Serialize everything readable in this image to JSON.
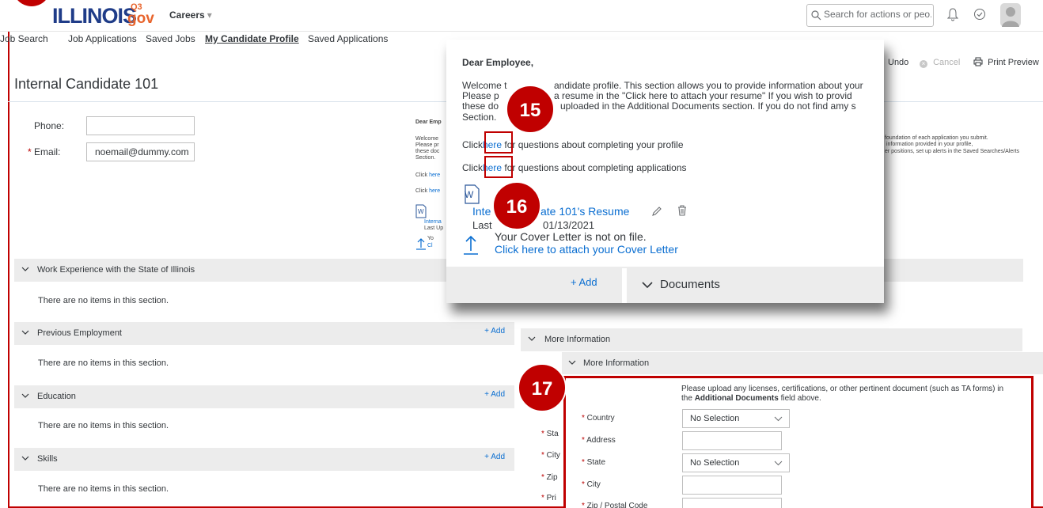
{
  "header": {
    "logo_main": "ILLINOIS",
    "logo_q3": "Q3",
    "logo_gov": "gov",
    "careers_label": "Careers",
    "search_placeholder": "Search for actions or peo..."
  },
  "nav": {
    "tabs": [
      {
        "label": "Job Search"
      },
      {
        "label": "Job Applications"
      },
      {
        "label": "Saved Jobs"
      },
      {
        "label": "My Candidate Profile",
        "active": true
      },
      {
        "label": "Saved Applications"
      }
    ]
  },
  "page": {
    "title": "Internal Candidate 101"
  },
  "toolbar": {
    "undo": "Undo",
    "cancel": "Cancel",
    "print_preview": "Print Preview"
  },
  "contact": {
    "phone_label": "Phone:",
    "phone_value": "",
    "email_label": "Email:",
    "email_value": "noemail@dummy.com"
  },
  "background_blurb": {
    "dear": "Dear Emp",
    "l1": "Welcome",
    "l2": "Please pr",
    "l3": "these doc",
    "l4": "Section.",
    "click1": "Click",
    "here1": "here",
    "click2": "Click",
    "here2": "here",
    "resume_short": "Interna",
    "last_up": "Last Up",
    "yo": "Yo",
    "cl": "Cl",
    "right1": "foundation of each application you submit.",
    "right2": "information provided in your profile,",
    "right3": "er positions, set up alerts in the Saved Searches/Alerts"
  },
  "sections": [
    {
      "title": "Work Experience with the State of Illinois",
      "empty": "There are no items in this section.",
      "add": ""
    },
    {
      "title": "Previous Employment",
      "empty": "There are no items in this section.",
      "add": "+ Add"
    },
    {
      "title": "Education",
      "empty": "There are no items in this section.",
      "add": "+ Add"
    },
    {
      "title": "Skills",
      "empty": "There are no items in this section.",
      "add": "+ Add"
    }
  ],
  "popup": {
    "greeting": "Dear Employee,",
    "welcome_start": "Welcome t",
    "welcome_end": "andidate profile. This section allows you to provide information about your",
    "please_start": "Please p",
    "please_end": "a resume in the \"Click here to attach your resume\" If you wish to provid",
    "these_start": "these do",
    "these_end": "uploaded in the Additional Documents section. If you do not find amy s",
    "section": "Section.",
    "click": "Click",
    "here": "here",
    "profile_q": "for questions about completing your profile",
    "apps_q": "for questions about completing applications",
    "resume_link": "Internal Candidate 101's Resume",
    "resume_start": "Inte",
    "resume_end": "ate 101's Resume",
    "last_updated_start": "Last",
    "last_updated_end": "01/13/2021",
    "cover_missing": "Your Cover Letter is not on file.",
    "cover_attach": "Click here to attach your Cover Letter",
    "add": "+ Add",
    "documents": "Documents"
  },
  "callouts": {
    "c15": "15",
    "c16": "16",
    "c17": "17"
  },
  "more_info": {
    "outer_title": "More Information",
    "inner_title": "More Information",
    "upload_note_1": "Please upload any licenses, certifications, or other pertinent document (such as TA forms) in",
    "upload_note_2a": "the",
    "upload_note_2b": "Additional Documents",
    "upload_note_2c": "field above.",
    "country_label": "Country",
    "country_value": "No Selection",
    "address_label": "Address",
    "state_label": "State",
    "state_value": "No Selection",
    "city_label": "City",
    "zip_label": "Zip / Postal Code",
    "left_peek": [
      "Sta",
      "City",
      "Zip",
      "Pri"
    ]
  },
  "colors": {
    "accent": "#0a6ed1",
    "callout": "#c00000",
    "header_blue": "#1f3c88"
  }
}
